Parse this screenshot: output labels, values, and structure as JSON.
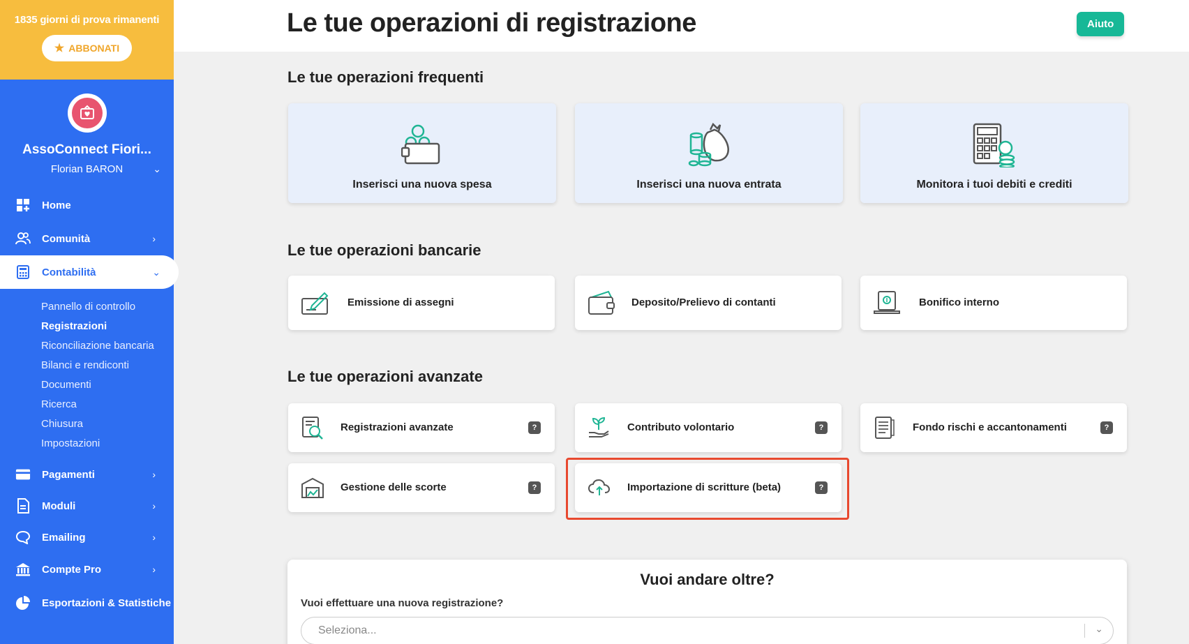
{
  "sidebar": {
    "trial_text": "1835 giorni di prova rimanenti",
    "subscribe_label": "ABBONATI",
    "org_name": "AssoConnect Fiori...",
    "user_name": "Florian BARON",
    "nav": {
      "home": "Home",
      "comunita": "Comunità",
      "contabilita": "Contabilità",
      "pagamenti": "Pagamenti",
      "moduli": "Moduli",
      "emailing": "Emailing",
      "compte_pro": "Compte Pro",
      "esportazioni": "Esportazioni & Statistiche"
    },
    "subnav": [
      "Pannello di controllo",
      "Registrazioni",
      "Riconciliazione bancaria",
      "Bilanci e rendiconti",
      "Documenti",
      "Ricerca",
      "Chiusura",
      "Impostazioni"
    ]
  },
  "header": {
    "title": "Le tue operazioni di registrazione",
    "help_label": "Aiuto"
  },
  "frequent": {
    "title": "Le tue operazioni frequenti",
    "items": [
      "Inserisci una nuova spesa",
      "Inserisci una nuova entrata",
      "Monitora i tuoi debiti e crediti"
    ]
  },
  "banking": {
    "title": "Le tue operazioni bancarie",
    "items": [
      "Emissione di assegni",
      "Deposito/Prelievo di contanti",
      "Bonifico interno"
    ]
  },
  "advanced": {
    "title": "Le tue operazioni avanzate",
    "items": [
      "Registrazioni avanzate",
      "Contributo volontario",
      "Fondo rischi e accantonamenti",
      "Gestione delle scorte",
      "Importazione di scritture (beta)"
    ],
    "help_mark": "?"
  },
  "more": {
    "title": "Vuoi andare oltre?",
    "question": "Vuoi effettuare una nuova registrazione?",
    "select_placeholder": "Seleziona..."
  },
  "colors": {
    "sidebar": "#2e6ef1",
    "trial_banner": "#f7bd3e",
    "help_button": "#17b897",
    "highlight": "#e8492f"
  }
}
